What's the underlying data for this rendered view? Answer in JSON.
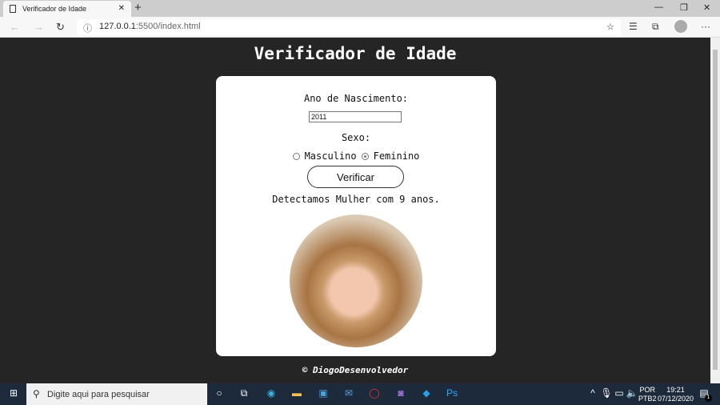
{
  "browser": {
    "tab_title": "Verificador de Idade",
    "url_host": "127.0.0.1",
    "url_rest": ":5500/index.html"
  },
  "page": {
    "title": "Verificador de Idade",
    "birth_label": "Ano de Nascimento:",
    "birth_value": "2011",
    "sex_label": "Sexo:",
    "options": [
      "Masculino",
      "Feminino"
    ],
    "selected": "Feminino",
    "button": "Verificar",
    "result": "Detectamos Mulher com 9 anos.",
    "footer": "© DiogoDesenvolvedor"
  },
  "taskbar": {
    "search_placeholder": "Digite aqui para pesquisar",
    "lang1": "POR",
    "lang2": "PTB2",
    "time": "19:21",
    "date": "07/12/2020",
    "notifications": "1"
  }
}
